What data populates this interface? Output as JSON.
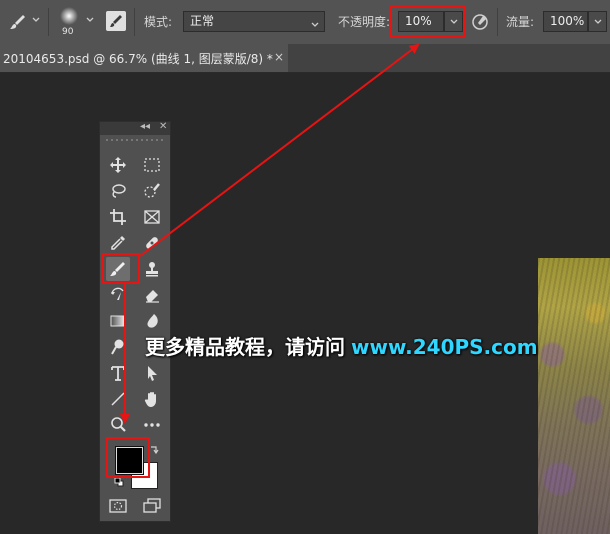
{
  "options_bar": {
    "brush_size": "90",
    "mode_label": "模式:",
    "mode_value": "正常",
    "opacity_label": "不透明度:",
    "opacity_value": "10%",
    "flow_label": "流量:",
    "flow_value": "100%"
  },
  "document_tab": {
    "title": "20104653.psd @ 66.7% (曲线 1, 图层蒙版/8) *",
    "close": "×"
  },
  "toolbox": {
    "collapse_glyph": "◂◂",
    "close_glyph": "✕",
    "tools": [
      "move",
      "marquee",
      "lasso",
      "quick-selection",
      "crop",
      "frame",
      "eyedropper",
      "healing-brush",
      "brush",
      "clone-stamp",
      "history-brush",
      "eraser",
      "gradient",
      "blur",
      "dodge",
      "pen",
      "type",
      "path-selection",
      "line",
      "hand",
      "zoom",
      "more",
      "foreground-color",
      "background-color",
      "quick-mask",
      "screen-mode"
    ],
    "foreground_color": "#000000",
    "background_color": "#ffffff"
  },
  "watermark": {
    "text": "更多精品教程，请访问",
    "url": "www.240PS.com"
  },
  "colors": {
    "annotation_red": "#e81313",
    "panel": "#535353",
    "canvas": "#282828",
    "watermark_url": "#2fd6ff"
  }
}
